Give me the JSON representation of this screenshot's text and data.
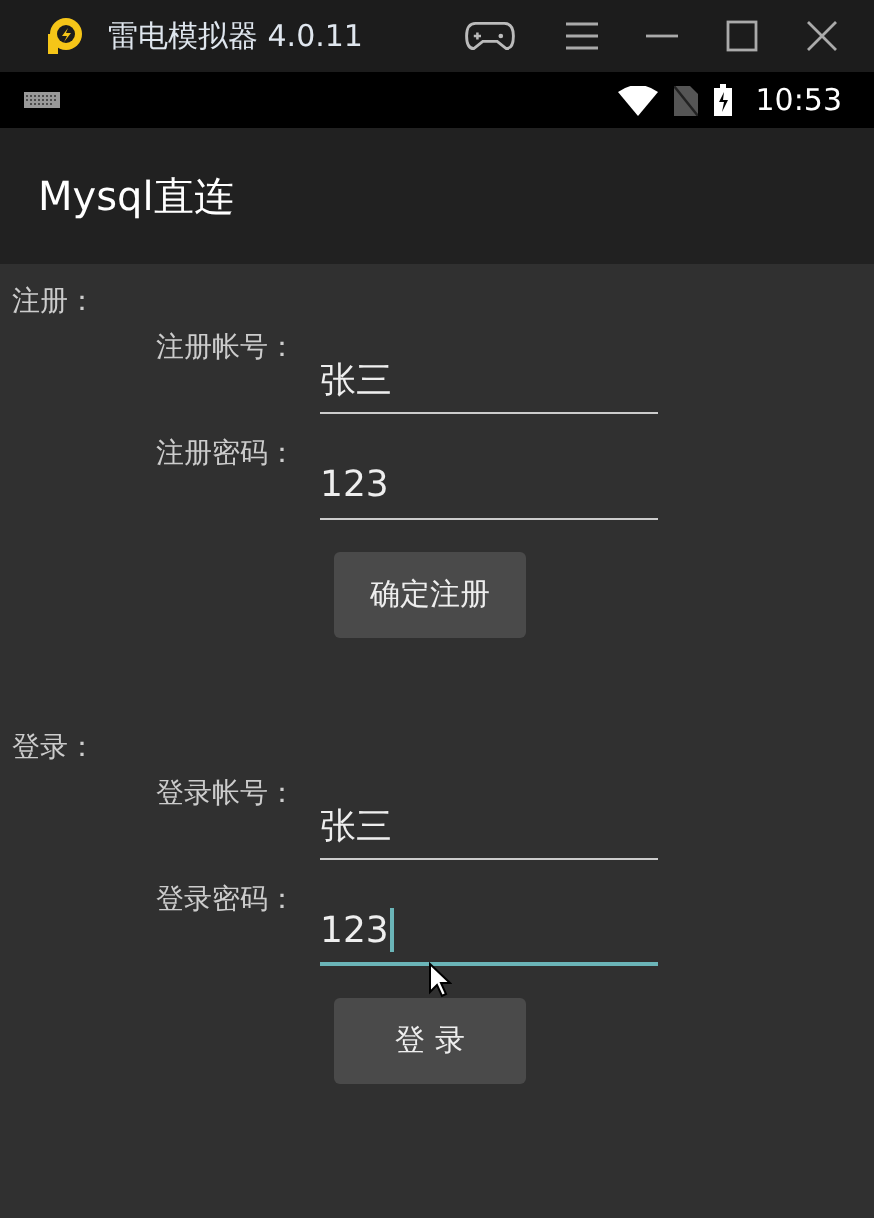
{
  "window": {
    "title": "雷电模拟器 4.0.11"
  },
  "status_bar": {
    "time": "10:53"
  },
  "app_bar": {
    "title": "Mysql直连"
  },
  "sections": [
    {
      "heading": "注册：",
      "fields": [
        {
          "label": "注册帐号：",
          "value": "张三",
          "focused": false
        },
        {
          "label": "注册密码：",
          "value": "123",
          "focused": false
        }
      ],
      "button": "确定注册"
    },
    {
      "heading": "登录：",
      "fields": [
        {
          "label": "登录帐号：",
          "value": "张三",
          "focused": false
        },
        {
          "label": "登录密码：",
          "value": "123",
          "focused": true
        }
      ],
      "button": "登 录"
    }
  ]
}
